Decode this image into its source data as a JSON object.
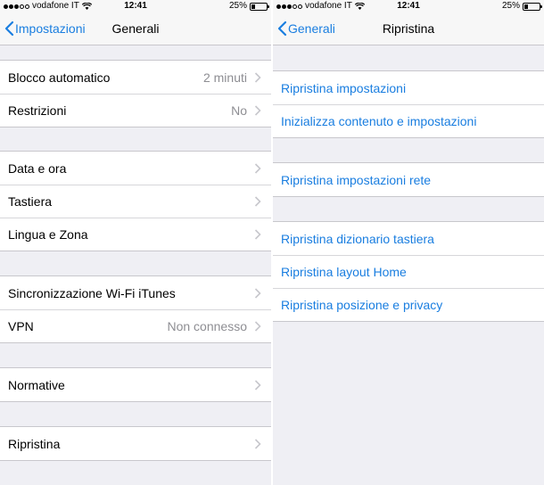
{
  "colors": {
    "accent": "#1a7ee0",
    "secondary_text": "#8e8e93",
    "background": "#efeff4"
  },
  "left": {
    "status": {
      "carrier": "vodafone IT",
      "time": "12:41",
      "battery": "25%",
      "battery_level": 0.25
    },
    "nav": {
      "back_label": "Impostazioni",
      "title": "Generali"
    },
    "groups": [
      [
        {
          "label": "Blocco automatico",
          "value": "2 minuti"
        },
        {
          "label": "Restrizioni",
          "value": "No"
        }
      ],
      [
        {
          "label": "Data e ora",
          "value": ""
        },
        {
          "label": "Tastiera",
          "value": ""
        },
        {
          "label": "Lingua e Zona",
          "value": ""
        }
      ],
      [
        {
          "label": "Sincronizzazione Wi-Fi iTunes",
          "value": ""
        },
        {
          "label": "VPN",
          "value": "Non connesso"
        }
      ],
      [
        {
          "label": "Normative",
          "value": ""
        }
      ],
      [
        {
          "label": "Ripristina",
          "value": ""
        }
      ]
    ]
  },
  "right": {
    "status": {
      "carrier": "vodafone IT",
      "time": "12:41",
      "battery": "25%",
      "battery_level": 0.25
    },
    "nav": {
      "back_label": "Generali",
      "title": "Ripristina"
    },
    "groups": [
      [
        {
          "label": "Ripristina impostazioni"
        },
        {
          "label": "Inizializza contenuto e impostazioni"
        }
      ],
      [
        {
          "label": "Ripristina impostazioni rete"
        }
      ],
      [
        {
          "label": "Ripristina dizionario tastiera"
        },
        {
          "label": "Ripristina layout Home"
        },
        {
          "label": "Ripristina posizione e privacy"
        }
      ]
    ]
  }
}
